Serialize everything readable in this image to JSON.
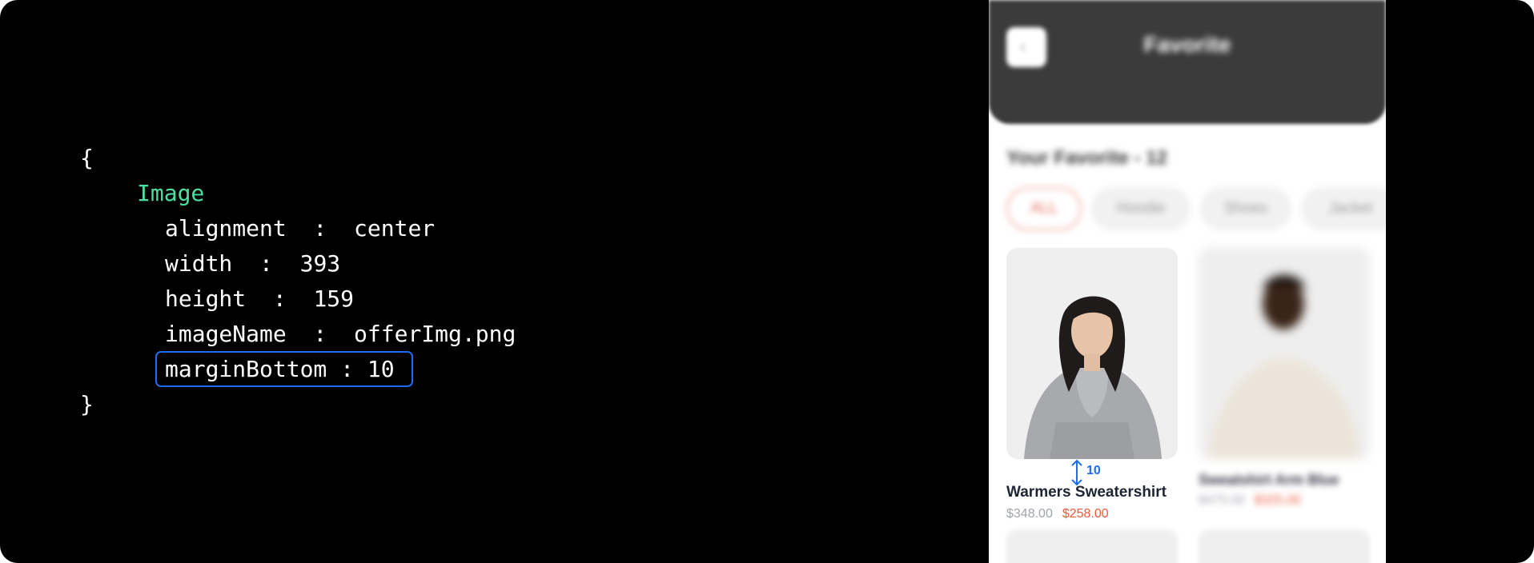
{
  "code": {
    "open_brace": "{",
    "component": "Image",
    "props": [
      {
        "key": "alignment",
        "sep": "  :  ",
        "value": "center"
      },
      {
        "key": "width",
        "sep": "  :  ",
        "value": "393"
      },
      {
        "key": "height",
        "sep": "  :  ",
        "value": "159"
      },
      {
        "key": "imageName",
        "sep": "  :  ",
        "value": "offerImg.png"
      }
    ],
    "highlight_text": "marginBottom : 10",
    "close_brace": "}"
  },
  "phone": {
    "header_title": "Favorite",
    "back_icon": "chevron-left-icon",
    "section_title": "Your Favorite - 12",
    "chips": [
      {
        "label": "ALL",
        "active": true
      },
      {
        "label": "Hoodie",
        "active": false
      },
      {
        "label": "Shoes",
        "active": false
      },
      {
        "label": "Jacket",
        "active": false
      }
    ],
    "product1": {
      "name": "Warmers Sweatershirt",
      "price": "$348.00",
      "sale_price": "$258.00"
    },
    "product2": {
      "name": "Sweatshirt Arm Blue",
      "price": "$475.00",
      "sale_price": "$325.00"
    },
    "spacing_value": "10"
  },
  "colors": {
    "background": "#000000",
    "keyword": "#4be0a1",
    "highlight": "#1d6cf2",
    "sale": "#ee5a3c"
  }
}
